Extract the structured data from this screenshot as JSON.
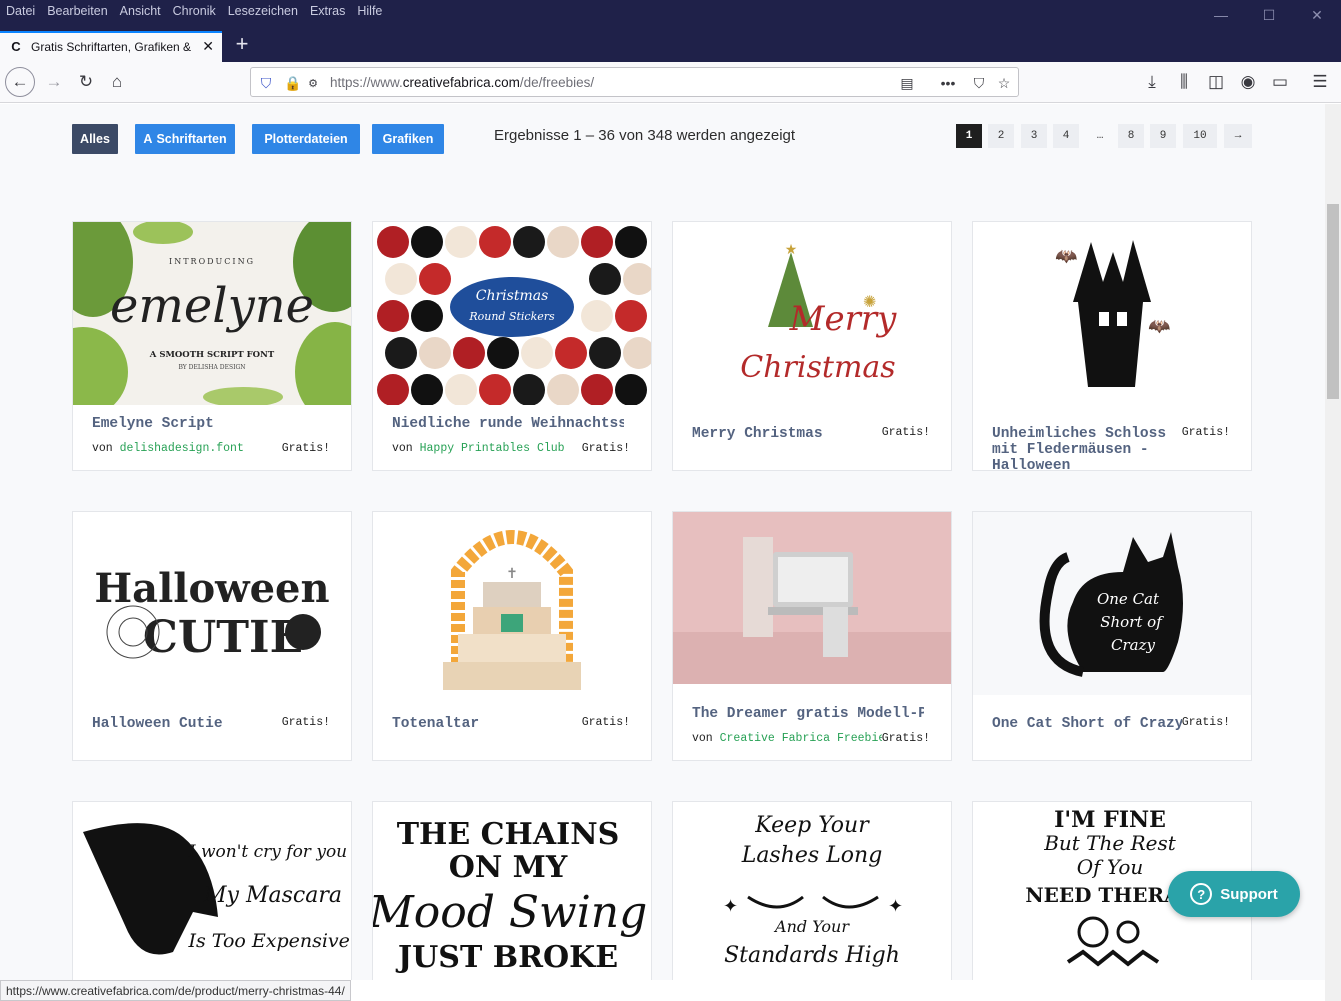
{
  "menu": [
    "Datei",
    "Bearbeiten",
    "Ansicht",
    "Chronik",
    "Lesezeichen",
    "Extras",
    "Hilfe"
  ],
  "tab": {
    "title": "Gratis Schriftarten, Grafiken & P",
    "favicon": "C"
  },
  "address": {
    "prefix": "https://www.",
    "domain": "creativefabrica.com",
    "path": "/de/freebies/"
  },
  "filters": {
    "all": "Alles",
    "fonts": "Schriftarten",
    "plot": "Plotterdateien",
    "graphics": "Grafiken"
  },
  "results": "Ergebnisse 1 – 36 von 348 werden angezeigt",
  "pagination": [
    "1",
    "2",
    "3",
    "4",
    "…",
    "8",
    "9",
    "10",
    "→"
  ],
  "cards": [
    {
      "title": "Emelyne Script",
      "by": "von",
      "author": "delishadesign.font",
      "price": "Gratis!"
    },
    {
      "title": "Niedliche runde Weihnachtssti",
      "by": "von",
      "author": "Happy Printables Club",
      "price": "Gratis!"
    },
    {
      "title": "Merry Christmas",
      "price": "Gratis!"
    },
    {
      "title": "Unheimliches Schloss",
      "title2": "mit Fledermäusen -",
      "title3": "Halloween",
      "price": "Gratis!"
    },
    {
      "title": "Halloween Cutie",
      "price": "Gratis!"
    },
    {
      "title": "Totenaltar",
      "price": "Gratis!"
    },
    {
      "title": "The Dreamer gratis Modell-Pa",
      "by": "von",
      "author": "Creative Fabrica Freebies",
      "price": "Gratis!"
    },
    {
      "title": "One Cat Short of Crazy",
      "price": "Gratis!"
    }
  ],
  "art": {
    "emelyne_intro": "INTRODUCING",
    "emelyne_name": "emelyne",
    "emelyne_sub": "A SMOOTH SCRIPT FONT",
    "emelyne_by": "BY DELISHA DESIGN",
    "stickers_1": "Christmas",
    "stickers_2": "Round Stickers",
    "merry_1": "Merry",
    "merry_2": "Christmas",
    "hw_1": "Halloween",
    "hw_2": "CUTIE",
    "cat_1": "One Cat",
    "cat_2": "Short of",
    "cat_3": "Crazy",
    "mascara_1": "I won't cry for you",
    "mascara_2": "My Mascara",
    "mascara_3": "Is Too Expensive!",
    "chains_1": "THE CHAINS",
    "chains_2": "ON MY",
    "chains_3": "Mood Swing",
    "chains_4": "JUST BROKE",
    "lashes_1": "Keep Your",
    "lashes_2": "Lashes Long",
    "lashes_3": "And Your",
    "lashes_4": "Standards High",
    "fine_1": "I'M FINE",
    "fine_2": "But The Rest",
    "fine_3": "Of You",
    "fine_4": "NEED THERAP"
  },
  "support": "Support",
  "status_url": "https://www.creativefabrica.com/de/product/merry-christmas-44/"
}
